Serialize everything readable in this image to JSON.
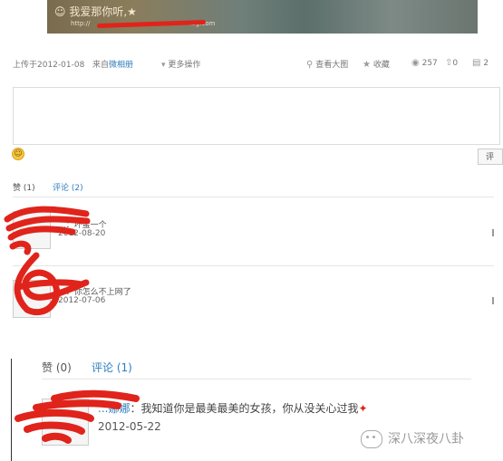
{
  "photo": {
    "caption": "☺ 我爱那你听,★",
    "url_partial": "http://",
    "url_tail": "log.com"
  },
  "meta": {
    "uploaded": "上传于2012-01-08",
    "from_label": "来自",
    "from_link": "微相册",
    "more_ops": "更多操作"
  },
  "toolbar": {
    "view_large": "查看大图",
    "favorite": "收藏",
    "views": "257",
    "shares": "0",
    "comments": "2"
  },
  "comment_input": {
    "value": ""
  },
  "submit_label": "评",
  "tabs": {
    "like": "赞",
    "like_count": "(1)",
    "comment": "评论",
    "comment_count": "(2)"
  },
  "comments": [
    {
      "user": "...",
      "text": "坏蛋一个",
      "date": "2012-08-20"
    },
    {
      "user": "...",
      "text": "你怎么不上网了",
      "date": "2012-07-06"
    }
  ],
  "section2": {
    "tabs": {
      "like": "赞",
      "like_count": "(0)",
      "comment": "评论",
      "comment_count": "(1)"
    },
    "comment": {
      "user": "...娜娜",
      "text": "我知道你是最美最美的女孩，你从没关心过我",
      "date": "2012-05-22"
    }
  },
  "watermark": "深八深夜八卦",
  "colors": {
    "link": "#2f7dbd",
    "scribble": "#e0241b"
  }
}
